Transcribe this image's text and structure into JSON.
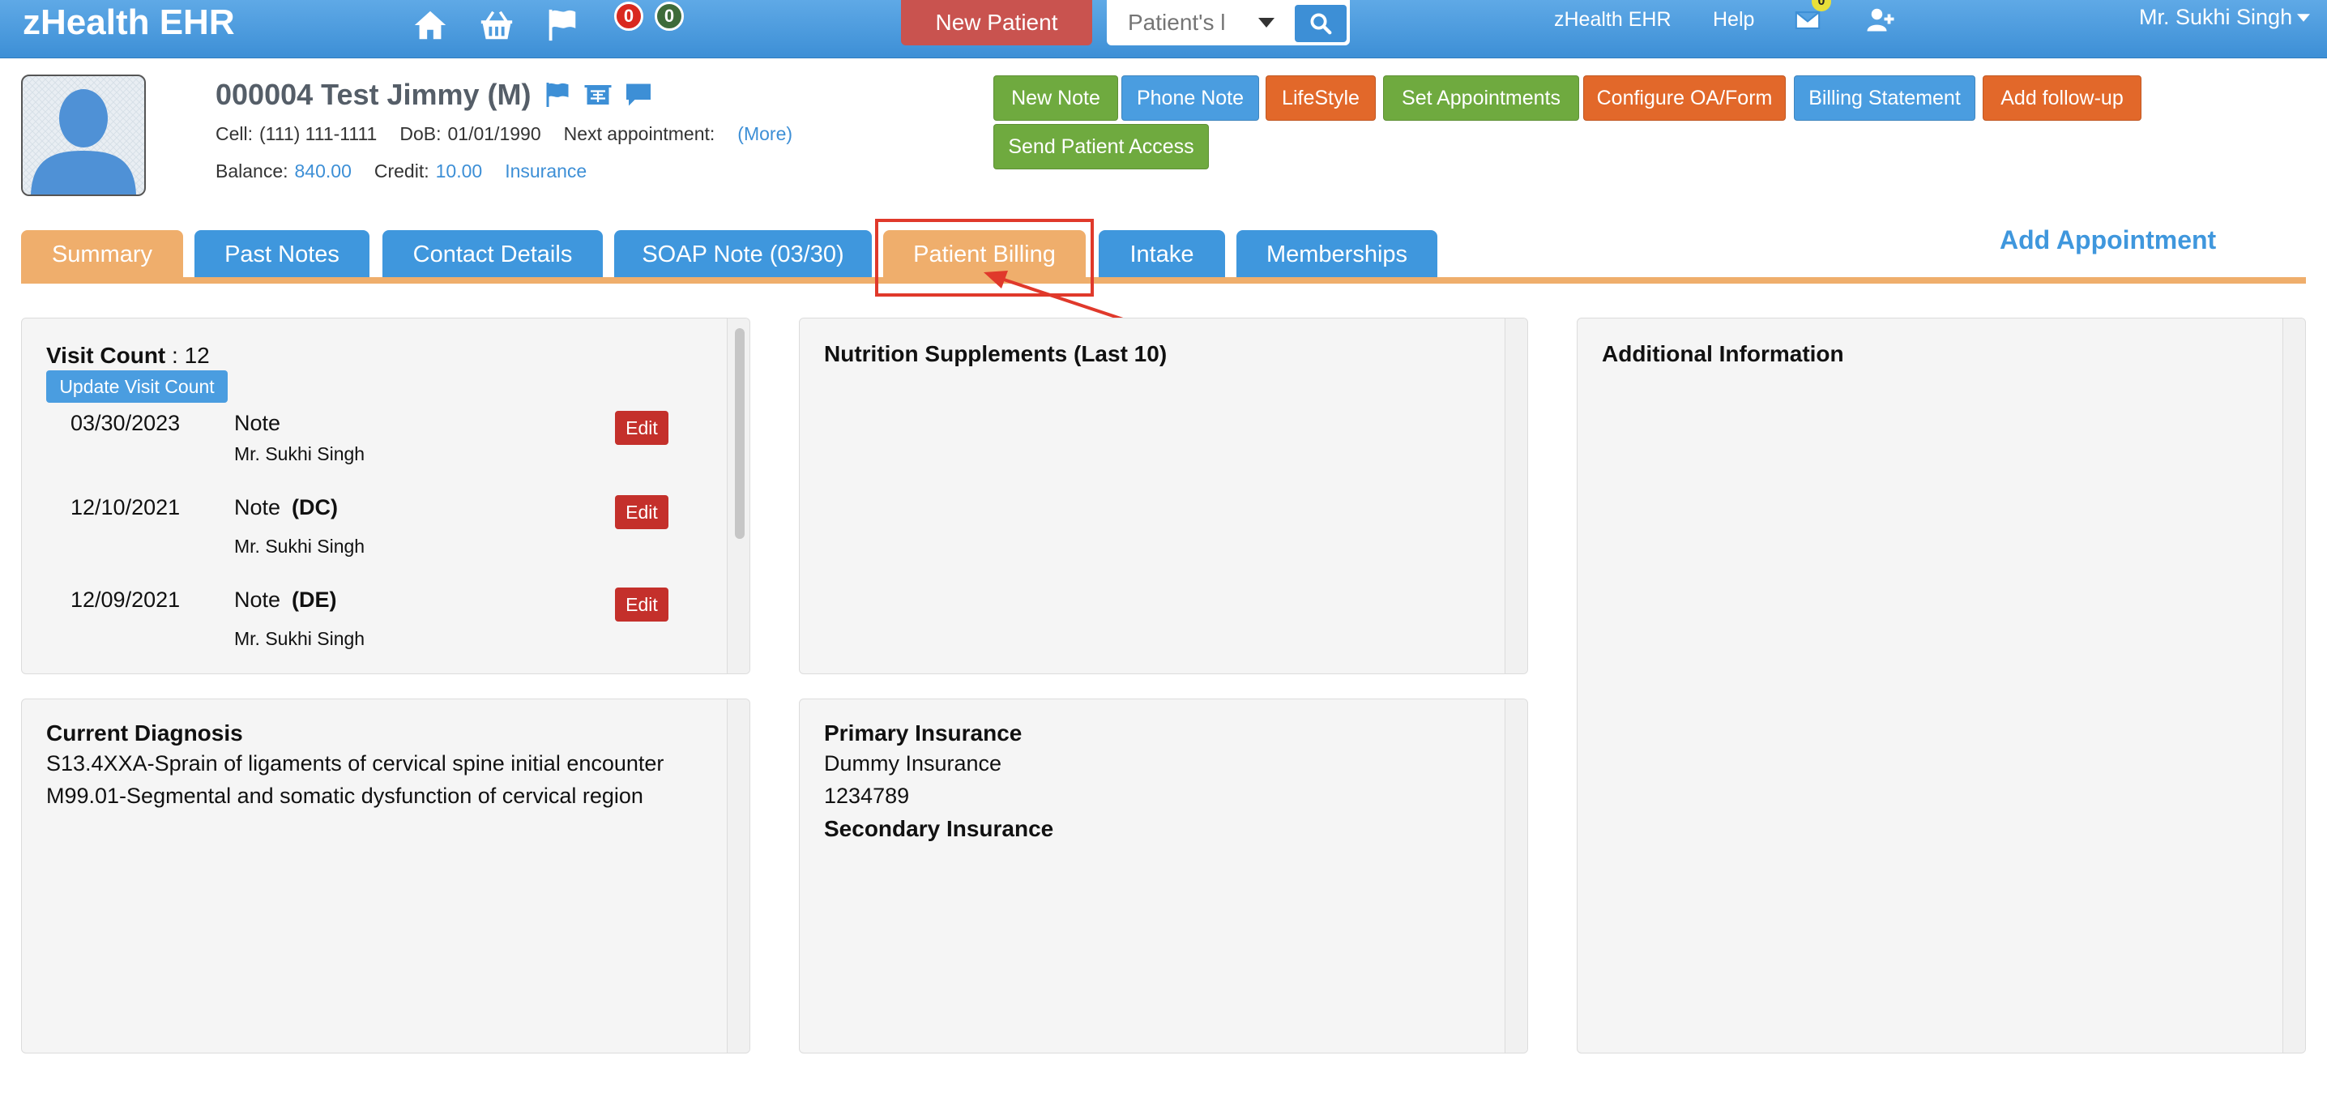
{
  "navbar": {
    "brand": "zHealth EHR",
    "icons": [
      "home-icon",
      "basket-icon",
      "flag-icon"
    ],
    "badge_red": "0",
    "badge_green": "0",
    "new_patient_label": "New Patient",
    "search_placeholder": "Patient's l",
    "app_link": "zHealth EHR",
    "help_link": "Help",
    "mail_count": "0",
    "user_name": "Mr. Sukhi Singh",
    "colors": {
      "bar": "#3d8fd6",
      "badge_red": "#d9291f",
      "badge_green": "#3e6b3a",
      "new_patient": "#c9534f"
    }
  },
  "patient": {
    "name": "000004 Test Jimmy (M)",
    "cell_label": "Cell:",
    "cell": "(111) 111-1111",
    "dob_label": "DoB:",
    "dob": "01/01/1990",
    "next_appt_label": "Next appointment:",
    "more_link": "(More)",
    "balance_label": "Balance:",
    "balance": "840.00",
    "credit_label": "Credit:",
    "credit": "10.00",
    "insurance_link": "Insurance"
  },
  "actions": {
    "new_note": "New Note",
    "phone_note": "Phone Note",
    "lifestyle": "LifeStyle",
    "set_appointments": "Set Appointments",
    "configure_oa": "Configure OA/Form",
    "billing_statement": "Billing Statement",
    "add_followup": "Add follow-up",
    "send_access": "Send Patient Access"
  },
  "tabs": {
    "summary": "Summary",
    "past_notes": "Past Notes",
    "contact_details": "Contact Details",
    "soap_note": "SOAP Note (03/30)",
    "patient_billing": "Patient Billing",
    "intake": "Intake",
    "memberships": "Memberships",
    "active": "Summary"
  },
  "add_appointment": "Add Appointment",
  "visits": {
    "label": "Visit Count",
    "count": "12",
    "update_label": "Update Visit Count",
    "edit_label": "Edit",
    "rows": [
      {
        "date": "03/30/2023",
        "note": "Note",
        "tag": "",
        "by": "Mr. Sukhi Singh"
      },
      {
        "date": "12/10/2021",
        "note": "Note",
        "tag": "(DC)",
        "by": "Mr. Sukhi Singh"
      },
      {
        "date": "12/09/2021",
        "note": "Note",
        "tag": "(DE)",
        "by": "Mr. Sukhi Singh"
      }
    ]
  },
  "nutrition": {
    "title": "Nutrition Supplements (Last 10)"
  },
  "additional": {
    "title": "Additional Information"
  },
  "diagnosis": {
    "title": "Current Diagnosis",
    "lines": [
      "S13.4XXA-Sprain of ligaments of cervical spine initial encounter",
      "M99.01-Segmental and somatic dysfunction of cervical region"
    ]
  },
  "insurance": {
    "primary_title": "Primary Insurance",
    "primary_name": "Dummy Insurance",
    "primary_id": "1234789",
    "secondary_title": "Secondary Insurance"
  }
}
